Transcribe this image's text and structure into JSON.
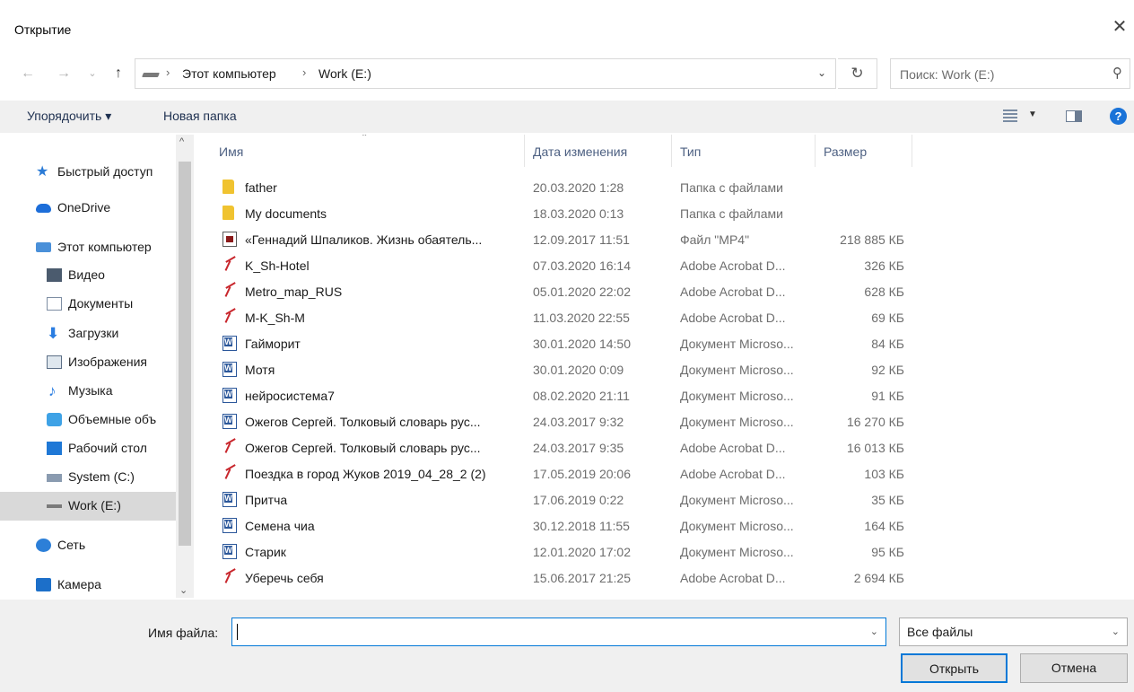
{
  "window": {
    "title": "Открытие"
  },
  "address": {
    "crumbs": [
      "Этот компьютер",
      "Work (E:)"
    ],
    "search_placeholder": "Поиск: Work (E:)"
  },
  "toolbar": {
    "organize": "Упорядочить ▾",
    "new_folder": "Новая папка"
  },
  "nav": {
    "items": [
      {
        "label": "Быстрый доступ",
        "icon": "star-icon"
      },
      {
        "label": "OneDrive",
        "icon": "cloud-icon"
      },
      {
        "label": "Этот компьютер",
        "icon": "computer-icon"
      },
      {
        "label": "Видео",
        "icon": "video-icon"
      },
      {
        "label": "Документы",
        "icon": "documents-icon"
      },
      {
        "label": "Загрузки",
        "icon": "download-icon"
      },
      {
        "label": "Изображения",
        "icon": "pictures-icon"
      },
      {
        "label": "Музыка",
        "icon": "music-icon"
      },
      {
        "label": "Объемные объ",
        "icon": "3d-objects-icon"
      },
      {
        "label": "Рабочий стол",
        "icon": "desktop-icon"
      },
      {
        "label": "System (C:)",
        "icon": "system-drive-icon"
      },
      {
        "label": "Work (E:)",
        "icon": "drive-icon",
        "selected": true
      },
      {
        "label": "Сеть",
        "icon": "network-icon"
      },
      {
        "label": "Камера",
        "icon": "camera-icon"
      }
    ]
  },
  "columns": {
    "name": "Имя",
    "date": "Дата изменения",
    "type": "Тип",
    "size": "Размер"
  },
  "files": [
    {
      "name": "father",
      "date": "20.03.2020 1:28",
      "type": "Папка с файлами",
      "size": "",
      "icon": "folder-icon"
    },
    {
      "name": "My documents",
      "date": "18.03.2020 0:13",
      "type": "Папка с файлами",
      "size": "",
      "icon": "folder-icon"
    },
    {
      "name": "«Геннадий Шпаликов. Жизнь обаятель...",
      "date": "12.09.2017 11:51",
      "type": "Файл \"MP4\"",
      "size": "218 885 КБ",
      "icon": "video-file-icon"
    },
    {
      "name": "K_Sh-Hotel",
      "date": "07.03.2020 16:14",
      "type": "Adobe Acrobat D...",
      "size": "326 КБ",
      "icon": "pdf-icon"
    },
    {
      "name": "Metro_map_RUS",
      "date": "05.01.2020 22:02",
      "type": "Adobe Acrobat D...",
      "size": "628 КБ",
      "icon": "pdf-icon"
    },
    {
      "name": "M-K_Sh-M",
      "date": "11.03.2020 22:55",
      "type": "Adobe Acrobat D...",
      "size": "69 КБ",
      "icon": "pdf-icon"
    },
    {
      "name": "Гайморит",
      "date": "30.01.2020 14:50",
      "type": "Документ Microso...",
      "size": "84 КБ",
      "icon": "word-icon"
    },
    {
      "name": "Мотя",
      "date": "30.01.2020 0:09",
      "type": "Документ Microso...",
      "size": "92 КБ",
      "icon": "word-icon"
    },
    {
      "name": "нейросистема7",
      "date": "08.02.2020 21:11",
      "type": "Документ Microso...",
      "size": "91 КБ",
      "icon": "word-icon"
    },
    {
      "name": "Ожегов Сергей. Толковый словарь рус...",
      "date": "24.03.2017 9:32",
      "type": "Документ Microso...",
      "size": "16 270 КБ",
      "icon": "word-icon"
    },
    {
      "name": "Ожегов Сергей. Толковый словарь рус...",
      "date": "24.03.2017 9:35",
      "type": "Adobe Acrobat D...",
      "size": "16 013 КБ",
      "icon": "pdf-icon"
    },
    {
      "name": "Поездка в город Жуков 2019_04_28_2 (2)",
      "date": "17.05.2019 20:06",
      "type": "Adobe Acrobat D...",
      "size": "103 КБ",
      "icon": "pdf-icon"
    },
    {
      "name": "Притча",
      "date": "17.06.2019 0:22",
      "type": "Документ Microso...",
      "size": "35 КБ",
      "icon": "word-icon"
    },
    {
      "name": "Семена чиа",
      "date": "30.12.2018 11:55",
      "type": "Документ Microso...",
      "size": "164 КБ",
      "icon": "word-icon"
    },
    {
      "name": "Старик",
      "date": "12.01.2020 17:02",
      "type": "Документ Microso...",
      "size": "95 КБ",
      "icon": "word-icon"
    },
    {
      "name": "Уберечь себя",
      "date": "15.06.2017 21:25",
      "type": "Adobe Acrobat D...",
      "size": "2 694 КБ",
      "icon": "pdf-icon"
    }
  ],
  "footer": {
    "filename_label": "Имя файла:",
    "filename_value": "",
    "filetype": "Все файлы",
    "open": "Открыть",
    "cancel": "Отмена"
  },
  "colors": {
    "accent": "#0078d7",
    "help": "#1a73d8",
    "pdf": "#c8262c",
    "word": "#2b579a",
    "folder": "#f0c330"
  }
}
